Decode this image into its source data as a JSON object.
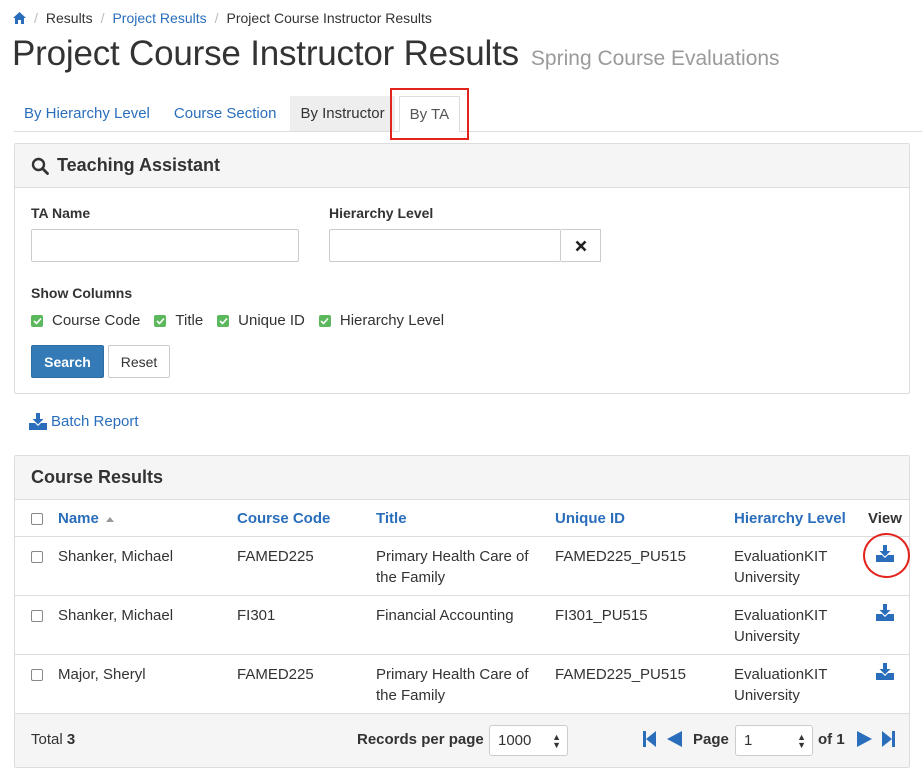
{
  "breadcrumb": {
    "items": [
      "Results",
      "Project Results",
      "Project Course Instructor Results"
    ]
  },
  "page": {
    "title": "Project Course Instructor Results",
    "subtitle": "Spring Course Evaluations"
  },
  "tabs": [
    "By Hierarchy Level",
    "Course Section",
    "By Instructor",
    "By TA"
  ],
  "search_panel": {
    "title": "Teaching Assistant",
    "ta_name_label": "TA Name",
    "ta_name_value": "",
    "hierarchy_label": "Hierarchy Level",
    "hierarchy_value": "",
    "show_columns_label": "Show Columns",
    "columns": [
      "Course Code",
      "Title",
      "Unique ID",
      "Hierarchy Level"
    ],
    "search_label": "Search",
    "reset_label": "Reset"
  },
  "batch_report_label": "Batch Report",
  "results": {
    "title": "Course Results",
    "headers": {
      "name": "Name",
      "course_code": "Course Code",
      "title": "Title",
      "unique_id": "Unique ID",
      "hierarchy": "Hierarchy Level",
      "view": "View"
    },
    "rows": [
      {
        "name": "Shanker, Michael",
        "course_code": "FAMED225",
        "title_1": "Primary Health Care of",
        "title_2": "the Family",
        "unique_id": "FAMED225_PU515",
        "hier_1": "EvaluationKIT",
        "hier_2": "University"
      },
      {
        "name": "Shanker, Michael",
        "course_code": "FI301",
        "title_1": "Financial Accounting",
        "title_2": "",
        "unique_id": "FI301_PU515",
        "hier_1": "EvaluationKIT",
        "hier_2": "University"
      },
      {
        "name": "Major, Sheryl",
        "course_code": "FAMED225",
        "title_1": "Primary Health Care of",
        "title_2": "the Family",
        "unique_id": "FAMED225_PU515",
        "hier_1": "EvaluationKIT",
        "hier_2": "University"
      }
    ],
    "footer": {
      "total_label": "Total",
      "total_value": "3",
      "records_label": "Records per page",
      "records_value": "1000",
      "page_label": "Page",
      "page_value": "1",
      "of_label": "of 1"
    }
  },
  "colors": {
    "link": "#2a6ebb",
    "primary_button": "#337ab7",
    "checkbox_green": "#5cb85c",
    "highlight_red": "#e3241c"
  },
  "icons": [
    "home-icon",
    "search-icon",
    "times-icon",
    "download-icon",
    "sort-asc-icon",
    "first-page-icon",
    "prev-page-icon",
    "next-page-icon",
    "last-page-icon"
  ]
}
